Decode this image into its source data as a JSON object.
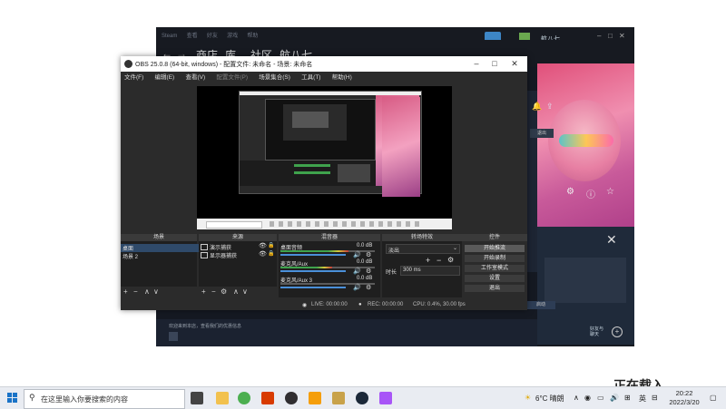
{
  "steam": {
    "nav_items": [
      "商店",
      "库",
      "社区",
      "航八七"
    ],
    "user_name": "航八七",
    "top_menu": [
      "Steam",
      "查看",
      "好友",
      "游戏",
      "帮助"
    ],
    "friends_label": "好友与\n聊天",
    "launch_btn": "启动",
    "notice": "欢迎来到本店，查看我们的优惠信息"
  },
  "obs": {
    "title": "OBS 25.0.8 (64-bit, windows) - 配置文件: 未命名 - 场景: 未命名",
    "menu": [
      "文件(F)",
      "编辑(E)",
      "查看(V)",
      "配置文件(P)",
      "场景集合(S)",
      "工具(T)",
      "帮助(H)"
    ],
    "docks": {
      "scenes": {
        "title": "场景",
        "items": [
          "桌面",
          "场景 2"
        ]
      },
      "sources": {
        "title": "来源",
        "items": [
          "演示捕获",
          "显示器捕获"
        ]
      },
      "mixer": {
        "title": "混音器",
        "channels": [
          {
            "name": "桌面音频",
            "db": "0.0 dB",
            "level": 0.72
          },
          {
            "name": "麦克风/Aux",
            "db": "0.0 dB",
            "level": 0.55
          },
          {
            "name": "麦克风/Aux 3",
            "db": "0.0 dB",
            "level": 0.0
          }
        ]
      },
      "transitions": {
        "title": "转场特效",
        "type": "淡出",
        "duration_label": "时长",
        "duration": "300 ms"
      },
      "controls": {
        "title": "控件",
        "buttons": [
          "开始推流",
          "开始录制",
          "工作室模式",
          "设置",
          "退出"
        ]
      }
    },
    "status": {
      "live": "LIVE: 00:00:00",
      "rec": "REC: 00:00:00",
      "cpu": "CPU: 0.4%, 30.00 fps"
    }
  },
  "taskbar": {
    "search_placeholder": "在这里输入你要搜索的内容",
    "weather": "6°C 晴朗",
    "lang": "英",
    "time": "20:22",
    "date": "2022/3/20",
    "icons": [
      "task-view-icon",
      "file-explorer-icon",
      "chrome-icon",
      "office-icon",
      "obs-icon",
      "package-icon",
      "league-icon",
      "steam-icon",
      "game-icon"
    ]
  },
  "desktop_text": "正在载入"
}
